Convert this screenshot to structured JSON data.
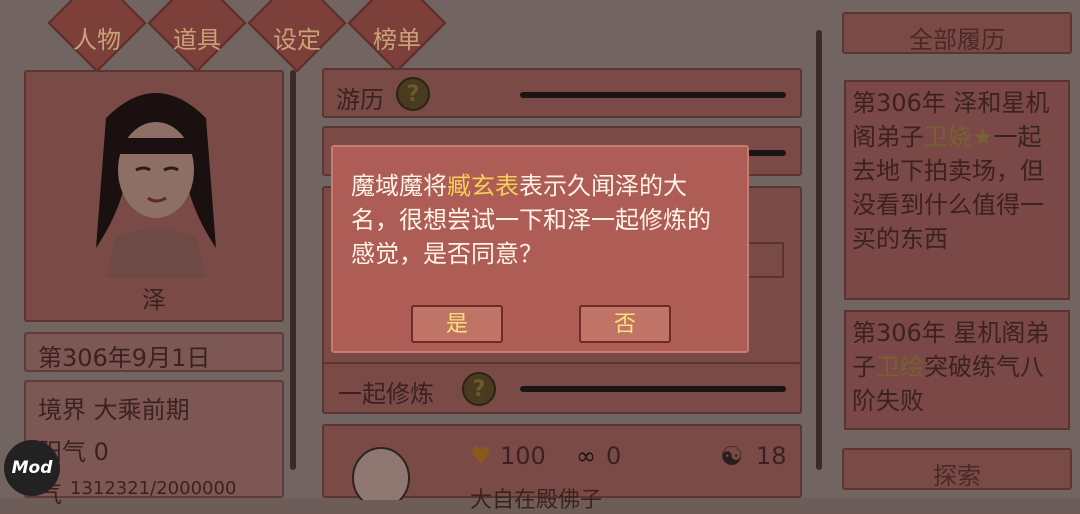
{
  "tabs": [
    "人物",
    "道具",
    "设定",
    "榜单"
  ],
  "character": {
    "name": "泽",
    "date": "第306年9月1日",
    "realm": "境界 大乘前期",
    "yang_qi": "阳气 0",
    "cultivation": "1312321/2000000",
    "cultivation_prefix": "气"
  },
  "middle": {
    "row1_label": "游历",
    "row3_label": "一起修炼",
    "npc_title": "大自在殿佛子",
    "stats": {
      "heart": "100",
      "chain": "0",
      "yinyang": "18"
    }
  },
  "dialog": {
    "text_before": "魔域魔将",
    "highlight": "臧玄表",
    "text_after": "表示久闻泽的大名，很想尝试一下和泽一起修炼的感觉，是否同意？",
    "yes_label": "是",
    "no_label": "否"
  },
  "right": {
    "header": "全部履历",
    "log1_pre": "第306年 泽和星机阁弟子",
    "log1_name": "卫娆★",
    "log1_post": "一起去地下拍卖场，但没看到什么值得一买的东西",
    "log2_pre": "第306年 星机阁弟子",
    "log2_name": "卫绘",
    "log2_post": "突破练气八阶失败",
    "explore_label": "探索"
  },
  "badge": "Mod",
  "colors": {
    "dialog_bg": "#ad5c56",
    "highlight": "#f6cf55",
    "button_text": "#fbe07a"
  }
}
